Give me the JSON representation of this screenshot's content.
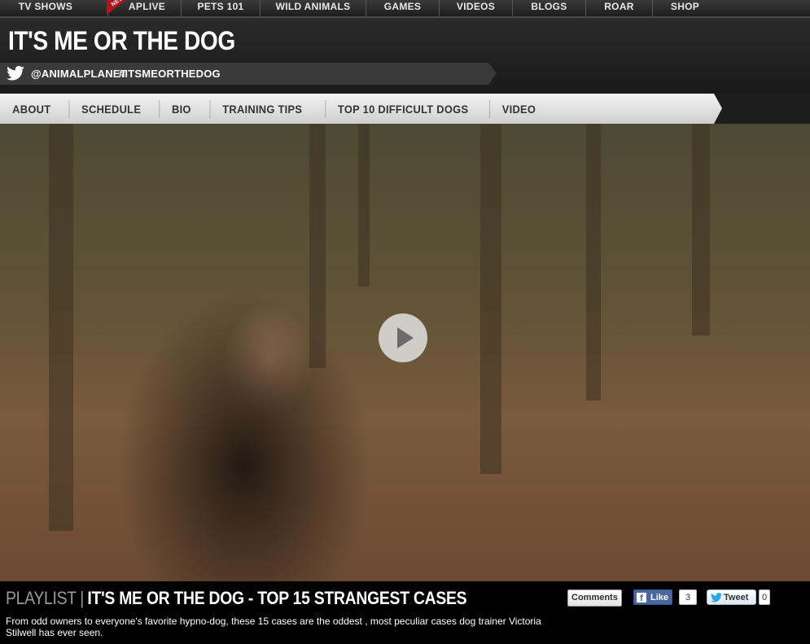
{
  "top_nav": {
    "items": [
      "TV SHOWS",
      "APLIVE",
      "PETS 101",
      "WILD ANIMALS",
      "GAMES",
      "VIDEOS",
      "BLOGS",
      "ROAR",
      "SHOP"
    ],
    "new_badge": "NEW"
  },
  "header": {
    "title": "IT'S ME OR THE DOG",
    "twitter_handle": "@ANIMALPLANET",
    "hashtag": "#ITSMEORTHEDOG"
  },
  "show_nav": {
    "items": [
      "ABOUT",
      "SCHEDULE",
      "BIO",
      "TRAINING TIPS",
      "TOP 10 DIFFICULT DOGS",
      "VIDEO"
    ]
  },
  "video": {
    "playlist_label": "PLAYLIST",
    "separator": "|",
    "title": "IT'S ME OR THE DOG - TOP 15 STRANGEST CASES",
    "description": "From odd owners to everyone's favorite hypno-dog, these 15 cases are the oddest , most peculiar cases dog trainer Victoria Stilwell has ever seen."
  },
  "social": {
    "comments_label": "Comments",
    "like_label": "Like",
    "like_count": "3",
    "tweet_label": "Tweet",
    "tweet_count": "0"
  },
  "colors": {
    "new_badge": "#b5121b",
    "facebook": "#4a66a0"
  }
}
